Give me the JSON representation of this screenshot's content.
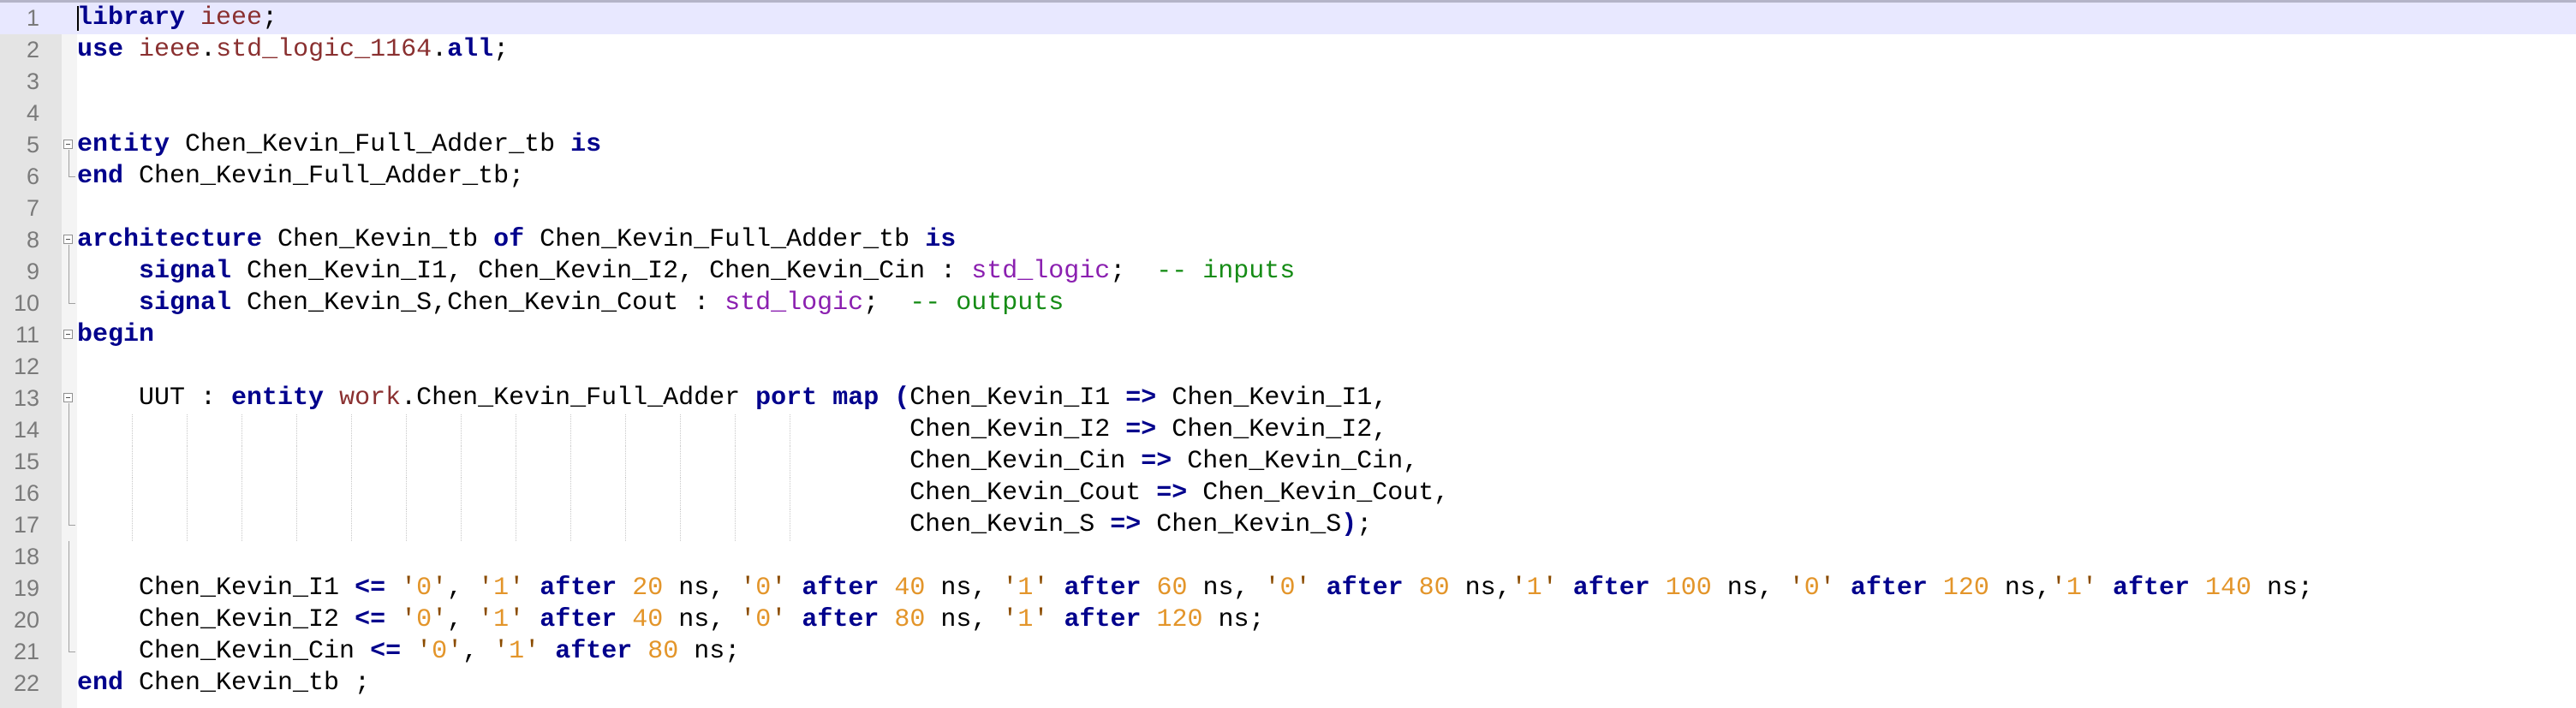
{
  "editor": {
    "lines": [
      {
        "number": "1",
        "tokens": [
          {
            "t": "library",
            "c": "kw"
          },
          {
            "t": " "
          },
          {
            "t": "ieee",
            "c": "lib"
          },
          {
            "t": ";"
          }
        ]
      },
      {
        "number": "2",
        "tokens": [
          {
            "t": "use",
            "c": "kw"
          },
          {
            "t": " "
          },
          {
            "t": "ieee",
            "c": "lib"
          },
          {
            "t": "."
          },
          {
            "t": "std_logic_1164",
            "c": "lib"
          },
          {
            "t": "."
          },
          {
            "t": "all",
            "c": "kw"
          },
          {
            "t": ";"
          }
        ]
      },
      {
        "number": "3",
        "tokens": []
      },
      {
        "number": "4",
        "tokens": []
      },
      {
        "number": "5",
        "tokens": [
          {
            "t": "entity",
            "c": "kw"
          },
          {
            "t": " Chen_Kevin_Full_Adder_tb "
          },
          {
            "t": "is",
            "c": "kw"
          }
        ]
      },
      {
        "number": "6",
        "tokens": [
          {
            "t": "end",
            "c": "kw"
          },
          {
            "t": " Chen_Kevin_Full_Adder_tb;"
          }
        ]
      },
      {
        "number": "7",
        "tokens": []
      },
      {
        "number": "8",
        "tokens": [
          {
            "t": "architecture",
            "c": "kw"
          },
          {
            "t": " Chen_Kevin_tb "
          },
          {
            "t": "of",
            "c": "kw"
          },
          {
            "t": " Chen_Kevin_Full_Adder_tb "
          },
          {
            "t": "is",
            "c": "kw"
          }
        ]
      },
      {
        "number": "9",
        "tokens": [
          {
            "t": "    "
          },
          {
            "t": "signal",
            "c": "kw"
          },
          {
            "t": " Chen_Kevin_I1, Chen_Kevin_I2, Chen_Kevin_Cin : "
          },
          {
            "t": "std_logic",
            "c": "type"
          },
          {
            "t": ";  "
          },
          {
            "t": "-- inputs",
            "c": "cmt"
          }
        ]
      },
      {
        "number": "10",
        "tokens": [
          {
            "t": "    "
          },
          {
            "t": "signal",
            "c": "kw"
          },
          {
            "t": " Chen_Kevin_S,Chen_Kevin_Cout : "
          },
          {
            "t": "std_logic",
            "c": "type"
          },
          {
            "t": ";  "
          },
          {
            "t": "-- outputs",
            "c": "cmt"
          }
        ]
      },
      {
        "number": "11",
        "tokens": [
          {
            "t": "begin",
            "c": "kw"
          }
        ]
      },
      {
        "number": "12",
        "tokens": []
      },
      {
        "number": "13",
        "tokens": [
          {
            "t": "    UUT : "
          },
          {
            "t": "entity",
            "c": "kw"
          },
          {
            "t": " "
          },
          {
            "t": "work",
            "c": "lib"
          },
          {
            "t": ".Chen_Kevin_Full_Adder "
          },
          {
            "t": "port",
            "c": "kw"
          },
          {
            "t": " "
          },
          {
            "t": "map",
            "c": "kw"
          },
          {
            "t": " "
          },
          {
            "t": "(",
            "c": "kw"
          },
          {
            "t": "Chen_Kevin_I1 "
          },
          {
            "t": "=>",
            "c": "kw"
          },
          {
            "t": " Chen_Kevin_I1,"
          }
        ]
      },
      {
        "number": "14",
        "tokens": [
          {
            "t": "                                                      Chen_Kevin_I2 "
          },
          {
            "t": "=>",
            "c": "kw"
          },
          {
            "t": " Chen_Kevin_I2,"
          }
        ]
      },
      {
        "number": "15",
        "tokens": [
          {
            "t": "                                                      Chen_Kevin_Cin "
          },
          {
            "t": "=>",
            "c": "kw"
          },
          {
            "t": " Chen_Kevin_Cin,"
          }
        ]
      },
      {
        "number": "16",
        "tokens": [
          {
            "t": "                                                      Chen_Kevin_Cout "
          },
          {
            "t": "=>",
            "c": "kw"
          },
          {
            "t": " Chen_Kevin_Cout,"
          }
        ]
      },
      {
        "number": "17",
        "tokens": [
          {
            "t": "                                                      Chen_Kevin_S "
          },
          {
            "t": "=>",
            "c": "kw"
          },
          {
            "t": " Chen_Kevin_S"
          },
          {
            "t": ")",
            "c": "kw"
          },
          {
            "t": ";"
          }
        ]
      },
      {
        "number": "18",
        "tokens": []
      },
      {
        "number": "19",
        "tokens": [
          {
            "t": "    Chen_Kevin_I1 "
          },
          {
            "t": "<=",
            "c": "kw"
          },
          {
            "t": " "
          },
          {
            "t": "'",
            "c": "str"
          },
          {
            "t": "0",
            "c": "num"
          },
          {
            "t": "'",
            "c": "str"
          },
          {
            "t": ", "
          },
          {
            "t": "'",
            "c": "str"
          },
          {
            "t": "1",
            "c": "num"
          },
          {
            "t": "'",
            "c": "str"
          },
          {
            "t": " "
          },
          {
            "t": "after",
            "c": "kw"
          },
          {
            "t": " "
          },
          {
            "t": "20",
            "c": "num"
          },
          {
            "t": " ns, "
          },
          {
            "t": "'",
            "c": "str"
          },
          {
            "t": "0",
            "c": "num"
          },
          {
            "t": "'",
            "c": "str"
          },
          {
            "t": " "
          },
          {
            "t": "after",
            "c": "kw"
          },
          {
            "t": " "
          },
          {
            "t": "40",
            "c": "num"
          },
          {
            "t": " ns, "
          },
          {
            "t": "'",
            "c": "str"
          },
          {
            "t": "1",
            "c": "num"
          },
          {
            "t": "'",
            "c": "str"
          },
          {
            "t": " "
          },
          {
            "t": "after",
            "c": "kw"
          },
          {
            "t": " "
          },
          {
            "t": "60",
            "c": "num"
          },
          {
            "t": " ns, "
          },
          {
            "t": "'",
            "c": "str"
          },
          {
            "t": "0",
            "c": "num"
          },
          {
            "t": "'",
            "c": "str"
          },
          {
            "t": " "
          },
          {
            "t": "after",
            "c": "kw"
          },
          {
            "t": " "
          },
          {
            "t": "80",
            "c": "num"
          },
          {
            "t": " ns,"
          },
          {
            "t": "'",
            "c": "str"
          },
          {
            "t": "1",
            "c": "num"
          },
          {
            "t": "'",
            "c": "str"
          },
          {
            "t": " "
          },
          {
            "t": "after",
            "c": "kw"
          },
          {
            "t": " "
          },
          {
            "t": "100",
            "c": "num"
          },
          {
            "t": " ns, "
          },
          {
            "t": "'",
            "c": "str"
          },
          {
            "t": "0",
            "c": "num"
          },
          {
            "t": "'",
            "c": "str"
          },
          {
            "t": " "
          },
          {
            "t": "after",
            "c": "kw"
          },
          {
            "t": " "
          },
          {
            "t": "120",
            "c": "num"
          },
          {
            "t": " ns,"
          },
          {
            "t": "'",
            "c": "str"
          },
          {
            "t": "1",
            "c": "num"
          },
          {
            "t": "'",
            "c": "str"
          },
          {
            "t": " "
          },
          {
            "t": "after",
            "c": "kw"
          },
          {
            "t": " "
          },
          {
            "t": "140",
            "c": "num"
          },
          {
            "t": " ns;"
          }
        ]
      },
      {
        "number": "20",
        "tokens": [
          {
            "t": "    Chen_Kevin_I2 "
          },
          {
            "t": "<=",
            "c": "kw"
          },
          {
            "t": " "
          },
          {
            "t": "'",
            "c": "str"
          },
          {
            "t": "0",
            "c": "num"
          },
          {
            "t": "'",
            "c": "str"
          },
          {
            "t": ", "
          },
          {
            "t": "'",
            "c": "str"
          },
          {
            "t": "1",
            "c": "num"
          },
          {
            "t": "'",
            "c": "str"
          },
          {
            "t": " "
          },
          {
            "t": "after",
            "c": "kw"
          },
          {
            "t": " "
          },
          {
            "t": "40",
            "c": "num"
          },
          {
            "t": " ns, "
          },
          {
            "t": "'",
            "c": "str"
          },
          {
            "t": "0",
            "c": "num"
          },
          {
            "t": "'",
            "c": "str"
          },
          {
            "t": " "
          },
          {
            "t": "after",
            "c": "kw"
          },
          {
            "t": " "
          },
          {
            "t": "80",
            "c": "num"
          },
          {
            "t": " ns, "
          },
          {
            "t": "'",
            "c": "str"
          },
          {
            "t": "1",
            "c": "num"
          },
          {
            "t": "'",
            "c": "str"
          },
          {
            "t": " "
          },
          {
            "t": "after",
            "c": "kw"
          },
          {
            "t": " "
          },
          {
            "t": "120",
            "c": "num"
          },
          {
            "t": " ns;"
          }
        ]
      },
      {
        "number": "21",
        "tokens": [
          {
            "t": "    Chen_Kevin_Cin "
          },
          {
            "t": "<=",
            "c": "kw"
          },
          {
            "t": " "
          },
          {
            "t": "'",
            "c": "str"
          },
          {
            "t": "0",
            "c": "num"
          },
          {
            "t": "'",
            "c": "str"
          },
          {
            "t": ", "
          },
          {
            "t": "'",
            "c": "str"
          },
          {
            "t": "1",
            "c": "num"
          },
          {
            "t": "'",
            "c": "str"
          },
          {
            "t": " "
          },
          {
            "t": "after",
            "c": "kw"
          },
          {
            "t": " "
          },
          {
            "t": "80",
            "c": "num"
          },
          {
            "t": " ns;"
          }
        ]
      },
      {
        "number": "22",
        "tokens": [
          {
            "t": "end",
            "c": "kw"
          },
          {
            "t": " Chen_Kevin_tb ;"
          }
        ]
      }
    ]
  }
}
